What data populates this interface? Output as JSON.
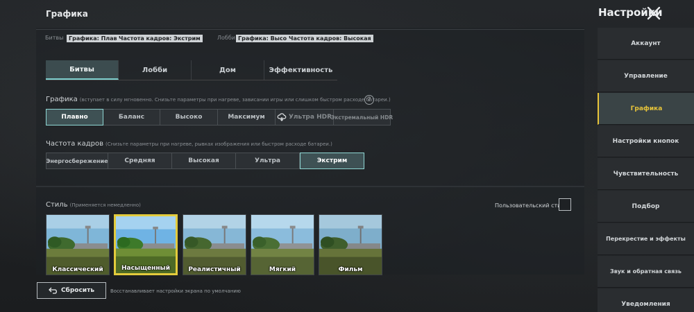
{
  "header": {
    "page_title": "Графика",
    "settings_title": "Настройки"
  },
  "summary": {
    "battles_label": "Битвы",
    "battles_graphics": "Графика: Плавно",
    "battles_fps": "Частота кадров: Экстрим",
    "lobby_label": "Лобби",
    "lobby_graphics": "Графика: Высоко",
    "lobby_fps": "Частота кадров: Высокая"
  },
  "tabs": [
    {
      "label": "Битвы",
      "active": true
    },
    {
      "label": "Лобби",
      "active": false
    },
    {
      "label": "Дом",
      "active": false
    },
    {
      "label": "Эффективность",
      "active": false
    }
  ],
  "graphics": {
    "title": "Графика",
    "hint": "(вступает в силу мгновенно. Снизьте параметры при нагреве, зависании игры или слишком быстром расходе батареи.)",
    "options": [
      "Плавно",
      "Баланс",
      "Высоко",
      "Максимум",
      "Ультра HDR",
      "Экстремальный HDR"
    ],
    "selected": "Плавно"
  },
  "fps": {
    "title": "Частота кадров",
    "hint": "(Снизьте параметры при нагреве, рывках изображения или быстром расходе батареи.)",
    "options": [
      "Энергосбережение",
      "Средняя",
      "Высокая",
      "Ультра",
      "Экстрим"
    ],
    "selected": "Экстрим"
  },
  "style": {
    "title": "Стиль",
    "hint": "(Применяется немедленно)",
    "custom_label": "Пользовательский стиль",
    "custom_checked": false,
    "options": [
      {
        "label": "Классический",
        "selected": false
      },
      {
        "label": "Насыщенный",
        "selected": true
      },
      {
        "label": "Реалистичный",
        "selected": false
      },
      {
        "label": "Мягкий",
        "selected": false
      },
      {
        "label": "Фильм",
        "selected": false
      }
    ]
  },
  "reset": {
    "label": "Сбросить",
    "hint": "Восстанавливает настройки экрана по умолчанию"
  },
  "sidebar": {
    "items": [
      {
        "label": "Аккаунт"
      },
      {
        "label": "Управление"
      },
      {
        "label": "Графика"
      },
      {
        "label": "Настройки кнопок"
      },
      {
        "label": "Чувствительность"
      },
      {
        "label": "Подбор"
      },
      {
        "label": "Перекрестие и эффекты"
      },
      {
        "label": "Звук и обратная связь"
      },
      {
        "label": "Уведомления"
      }
    ],
    "active": "Графика"
  },
  "colors": {
    "accent_teal": "#8fd7d4",
    "accent_yellow": "#e3cb3c",
    "background": "#1c1e20"
  }
}
